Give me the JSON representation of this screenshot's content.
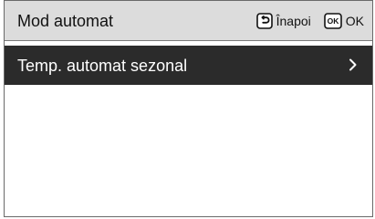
{
  "header": {
    "title": "Mod automat",
    "back_label": "Înapoi",
    "back_icon": "back-return-icon",
    "ok_icon": "ok-key-icon",
    "ok_icon_text": "OK",
    "ok_label": "OK"
  },
  "menu": {
    "items": [
      {
        "label": "Temp. automat sezonal",
        "icon": "chevron-right-icon",
        "selected": true
      }
    ]
  },
  "colors": {
    "header_bg": "#dcdcdc",
    "selected_bg": "#2b2b2b",
    "selected_text": "#ffffff",
    "text": "#111111",
    "border": "#6a6a6a"
  }
}
